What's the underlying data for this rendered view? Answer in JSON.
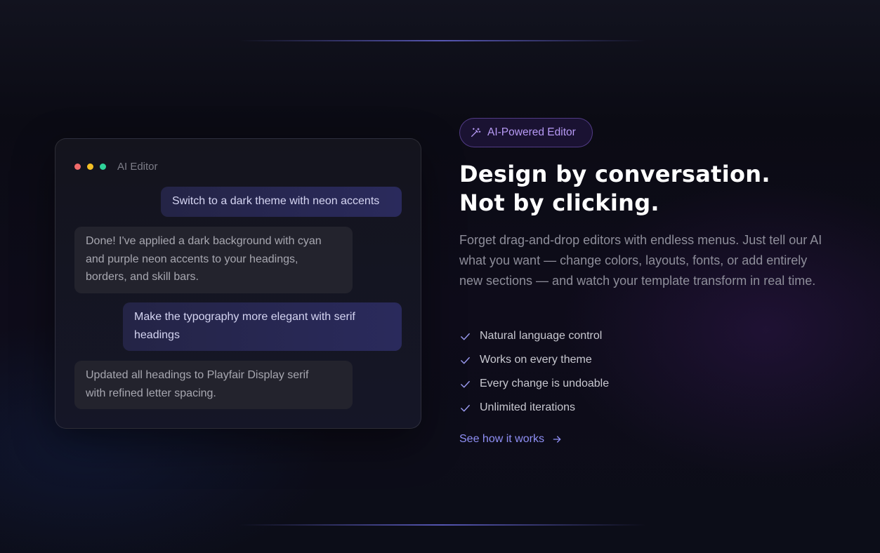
{
  "editor": {
    "title": "AI Editor",
    "window_dots": [
      "#f06a6a",
      "#f4c025",
      "#2fd49a"
    ],
    "messages": [
      {
        "role": "user",
        "text": "Switch to a dark theme with neon accents"
      },
      {
        "role": "ai",
        "text": "Done! I've applied a dark background with cyan and purple neon accents to your headings, borders, and skill bars."
      },
      {
        "role": "user",
        "text": "Make the typography more elegant with serif headings"
      },
      {
        "role": "ai",
        "text": "Updated all headings to Playfair Display serif with refined letter spacing."
      }
    ]
  },
  "badge": {
    "icon": "magic-wand-icon",
    "label": "AI-Powered Editor"
  },
  "headline": {
    "line1": "Design by conversation.",
    "line2": "Not by clicking."
  },
  "description": "Forget drag-and-drop editors with endless menus. Just tell our AI what you want — change colors, layouts, fonts, or add entirely new sections — and watch your template transform in real time.",
  "features": [
    {
      "icon": "check-icon",
      "label": "Natural language control"
    },
    {
      "icon": "check-icon",
      "label": "Works on every theme"
    },
    {
      "icon": "check-icon",
      "label": "Every change is undoable"
    },
    {
      "icon": "check-icon",
      "label": "Unlimited iterations"
    }
  ],
  "cta": {
    "label": "See how it works",
    "icon": "arrow-right-icon"
  },
  "colors": {
    "accent": "#8f8ff5",
    "badge_text": "#b79af5",
    "check": "#9a9af0"
  }
}
